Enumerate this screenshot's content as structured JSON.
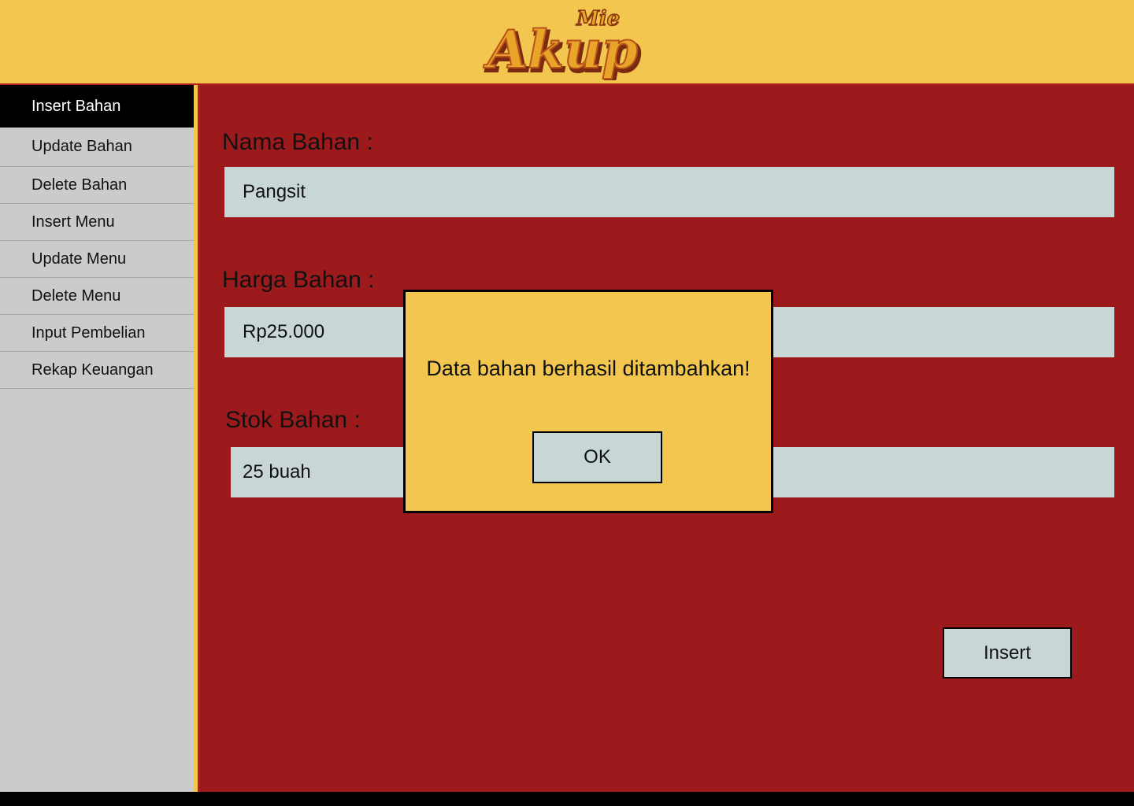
{
  "brand": {
    "logo_small": "Mie",
    "logo_big": "Akup",
    "colors": {
      "header_bg": "#f2c64f",
      "main_bg": "#9c1a1c",
      "sidebar_bg": "#cbcbcb",
      "field_bg": "#c8d6d6"
    }
  },
  "sidebar": {
    "items": [
      {
        "label": "Insert Bahan",
        "active": true
      },
      {
        "label": "Update Bahan"
      },
      {
        "label": "Delete Bahan"
      },
      {
        "label": "Insert Menu"
      },
      {
        "label": "Update Menu"
      },
      {
        "label": "Delete Menu"
      },
      {
        "label": "Input Pembelian"
      },
      {
        "label": "Rekap Keuangan"
      }
    ]
  },
  "form": {
    "nama_label": "Nama Bahan :",
    "nama_value": "Pangsit",
    "harga_label": "Harga Bahan :",
    "harga_value": "Rp25.000",
    "stok_label": "Stok Bahan :",
    "stok_value": "25 buah",
    "insert_label": "Insert"
  },
  "dialog": {
    "message": "Data bahan berhasil ditambahkan!",
    "ok_label": "OK"
  }
}
